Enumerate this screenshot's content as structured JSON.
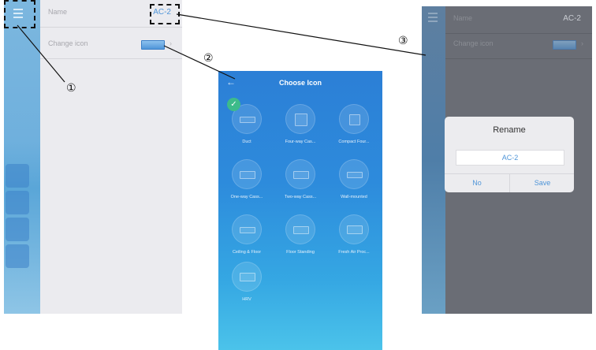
{
  "left_screen": {
    "menu_icon": "hamburger-menu-icon",
    "name_label": "Name",
    "name_value": "AC-2",
    "change_icon_label": "Change icon",
    "chevron": "›"
  },
  "callouts": {
    "one": "①",
    "two": "②",
    "three": "③"
  },
  "choose_icon": {
    "back_icon": "←",
    "title": "Choose Icon",
    "items": [
      {
        "label": "Duct",
        "selected": true
      },
      {
        "label": "Four-way Cas..."
      },
      {
        "label": "Compact Four..."
      },
      {
        "label": "One-way Cass..."
      },
      {
        "label": "Two-way Cass..."
      },
      {
        "label": "Wall-mounted"
      },
      {
        "label": "Ceiling & Floor"
      },
      {
        "label": "Floor Standing"
      },
      {
        "label": "Fresh Air Proc..."
      },
      {
        "label": "HRV"
      }
    ]
  },
  "right_screen": {
    "name_label": "Name",
    "name_value": "AC-2",
    "change_icon_label": "Change icon",
    "chevron": "›",
    "dialog": {
      "title": "Rename",
      "input_value": "AC-2",
      "no_label": "No",
      "save_label": "Save"
    }
  },
  "colors": {
    "accent_blue": "#4f95d8",
    "check_green": "#3dbb8a"
  }
}
